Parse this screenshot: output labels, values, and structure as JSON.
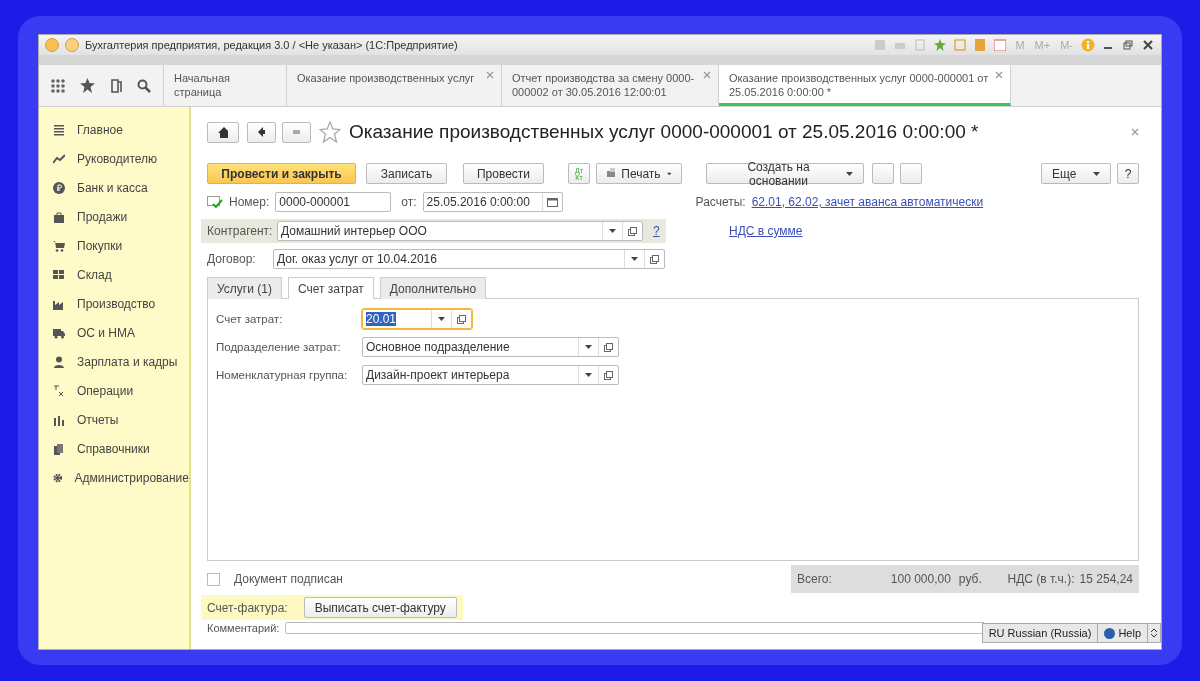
{
  "window": {
    "title": "Бухгалтерия предприятия, редакция 3.0 / <Не указан>  (1С:Предприятие)",
    "memory_buttons": [
      "M",
      "M+",
      "M-"
    ]
  },
  "nav_tabs": [
    {
      "label": "Начальная страница",
      "closable": false,
      "selected": false
    },
    {
      "label": "Оказание производственных услуг",
      "closable": true,
      "selected": false
    },
    {
      "label": "Отчет производства за смену 0000-000002 от 30.05.2016 12:00:01",
      "closable": true,
      "selected": false
    },
    {
      "label": "Оказание производственных услуг 0000-000001 от 25.05.2016 0:00:00 *",
      "closable": true,
      "selected": true
    }
  ],
  "sidebar": {
    "items": [
      {
        "label": "Главное"
      },
      {
        "label": "Руководителю"
      },
      {
        "label": "Банк и касса"
      },
      {
        "label": "Продажи"
      },
      {
        "label": "Покупки"
      },
      {
        "label": "Склад"
      },
      {
        "label": "Производство"
      },
      {
        "label": "ОС и НМА"
      },
      {
        "label": "Зарплата и кадры"
      },
      {
        "label": "Операции"
      },
      {
        "label": "Отчеты"
      },
      {
        "label": "Справочники"
      },
      {
        "label": "Администрирование"
      }
    ]
  },
  "document": {
    "title": "Оказание производственных услуг 0000-000001 от 25.05.2016 0:00:00 *",
    "buttons": {
      "post_close": "Провести и закрыть",
      "save": "Записать",
      "post": "Провести",
      "dtkt": "Дт Кт",
      "print": "Печать",
      "create_based": "Создать на основании",
      "more": "Еще",
      "help": "?"
    },
    "number": {
      "label": "Номер:",
      "value": "0000-000001"
    },
    "date": {
      "label": "от:",
      "value": "25.05.2016  0:00:00"
    },
    "settlements": {
      "label": "Расчеты:",
      "link": "62.01, 62.02, зачет аванса автоматически"
    },
    "vat_link": "НДС в сумме",
    "counterparty": {
      "label": "Контрагент:",
      "value": "Домашний интерьер ООО",
      "help": "?"
    },
    "contract": {
      "label": "Договор:",
      "value": "Дог. оказ услуг от 10.04.2016"
    },
    "tabs": [
      {
        "label": "Услуги (1)",
        "selected": false
      },
      {
        "label": "Счет затрат",
        "selected": true
      },
      {
        "label": "Дополнительно",
        "selected": false
      }
    ],
    "cost_fields": [
      {
        "label": "Счет затрат:",
        "value": "20.01",
        "focused": true
      },
      {
        "label": "Подразделение затрат:",
        "value": "Основное подразделение",
        "focused": false
      },
      {
        "label": "Номенклатурная группа:",
        "value": "Дизайн-проект интерьера",
        "focused": false
      }
    ],
    "signed": {
      "label": "Документ подписан",
      "checked": false
    },
    "totals": {
      "total_label": "Всего:",
      "total": "100 000,00",
      "currency": "руб.",
      "vat_label": "НДС (в т.ч.):",
      "vat": "15 254,24"
    },
    "invoice": {
      "label": "Счет-фактура:",
      "button": "Выписать счет-фактуру"
    },
    "comment": {
      "label": "Комментарий:"
    }
  },
  "language_bar": {
    "language": "RU Russian (Russia)",
    "help": "Help"
  }
}
